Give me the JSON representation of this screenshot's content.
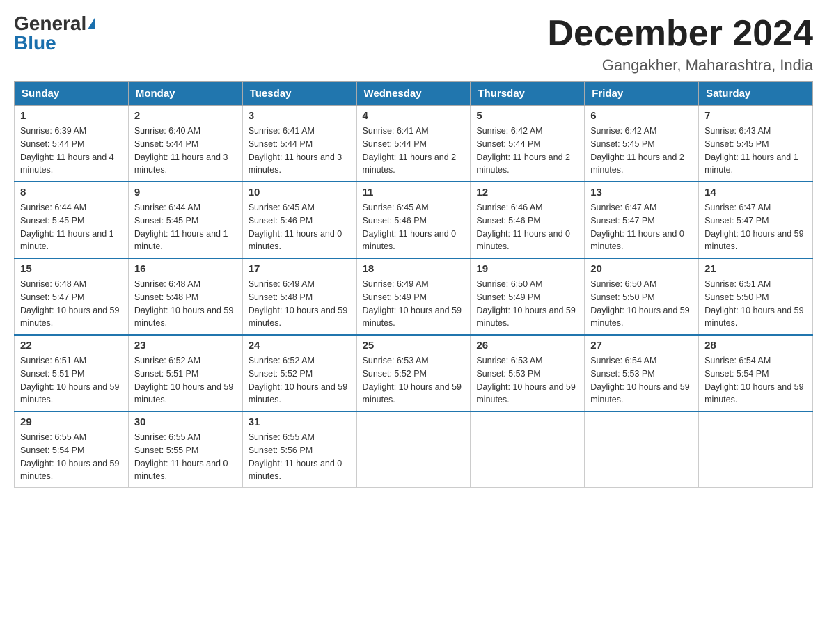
{
  "header": {
    "logo_general": "General",
    "logo_blue": "Blue",
    "month_year": "December 2024",
    "location": "Gangakher, Maharashtra, India"
  },
  "days_of_week": [
    "Sunday",
    "Monday",
    "Tuesday",
    "Wednesday",
    "Thursday",
    "Friday",
    "Saturday"
  ],
  "weeks": [
    [
      {
        "day": "1",
        "sunrise": "6:39 AM",
        "sunset": "5:44 PM",
        "daylight": "11 hours and 4 minutes."
      },
      {
        "day": "2",
        "sunrise": "6:40 AM",
        "sunset": "5:44 PM",
        "daylight": "11 hours and 3 minutes."
      },
      {
        "day": "3",
        "sunrise": "6:41 AM",
        "sunset": "5:44 PM",
        "daylight": "11 hours and 3 minutes."
      },
      {
        "day": "4",
        "sunrise": "6:41 AM",
        "sunset": "5:44 PM",
        "daylight": "11 hours and 2 minutes."
      },
      {
        "day": "5",
        "sunrise": "6:42 AM",
        "sunset": "5:44 PM",
        "daylight": "11 hours and 2 minutes."
      },
      {
        "day": "6",
        "sunrise": "6:42 AM",
        "sunset": "5:45 PM",
        "daylight": "11 hours and 2 minutes."
      },
      {
        "day": "7",
        "sunrise": "6:43 AM",
        "sunset": "5:45 PM",
        "daylight": "11 hours and 1 minute."
      }
    ],
    [
      {
        "day": "8",
        "sunrise": "6:44 AM",
        "sunset": "5:45 PM",
        "daylight": "11 hours and 1 minute."
      },
      {
        "day": "9",
        "sunrise": "6:44 AM",
        "sunset": "5:45 PM",
        "daylight": "11 hours and 1 minute."
      },
      {
        "day": "10",
        "sunrise": "6:45 AM",
        "sunset": "5:46 PM",
        "daylight": "11 hours and 0 minutes."
      },
      {
        "day": "11",
        "sunrise": "6:45 AM",
        "sunset": "5:46 PM",
        "daylight": "11 hours and 0 minutes."
      },
      {
        "day": "12",
        "sunrise": "6:46 AM",
        "sunset": "5:46 PM",
        "daylight": "11 hours and 0 minutes."
      },
      {
        "day": "13",
        "sunrise": "6:47 AM",
        "sunset": "5:47 PM",
        "daylight": "11 hours and 0 minutes."
      },
      {
        "day": "14",
        "sunrise": "6:47 AM",
        "sunset": "5:47 PM",
        "daylight": "10 hours and 59 minutes."
      }
    ],
    [
      {
        "day": "15",
        "sunrise": "6:48 AM",
        "sunset": "5:47 PM",
        "daylight": "10 hours and 59 minutes."
      },
      {
        "day": "16",
        "sunrise": "6:48 AM",
        "sunset": "5:48 PM",
        "daylight": "10 hours and 59 minutes."
      },
      {
        "day": "17",
        "sunrise": "6:49 AM",
        "sunset": "5:48 PM",
        "daylight": "10 hours and 59 minutes."
      },
      {
        "day": "18",
        "sunrise": "6:49 AM",
        "sunset": "5:49 PM",
        "daylight": "10 hours and 59 minutes."
      },
      {
        "day": "19",
        "sunrise": "6:50 AM",
        "sunset": "5:49 PM",
        "daylight": "10 hours and 59 minutes."
      },
      {
        "day": "20",
        "sunrise": "6:50 AM",
        "sunset": "5:50 PM",
        "daylight": "10 hours and 59 minutes."
      },
      {
        "day": "21",
        "sunrise": "6:51 AM",
        "sunset": "5:50 PM",
        "daylight": "10 hours and 59 minutes."
      }
    ],
    [
      {
        "day": "22",
        "sunrise": "6:51 AM",
        "sunset": "5:51 PM",
        "daylight": "10 hours and 59 minutes."
      },
      {
        "day": "23",
        "sunrise": "6:52 AM",
        "sunset": "5:51 PM",
        "daylight": "10 hours and 59 minutes."
      },
      {
        "day": "24",
        "sunrise": "6:52 AM",
        "sunset": "5:52 PM",
        "daylight": "10 hours and 59 minutes."
      },
      {
        "day": "25",
        "sunrise": "6:53 AM",
        "sunset": "5:52 PM",
        "daylight": "10 hours and 59 minutes."
      },
      {
        "day": "26",
        "sunrise": "6:53 AM",
        "sunset": "5:53 PM",
        "daylight": "10 hours and 59 minutes."
      },
      {
        "day": "27",
        "sunrise": "6:54 AM",
        "sunset": "5:53 PM",
        "daylight": "10 hours and 59 minutes."
      },
      {
        "day": "28",
        "sunrise": "6:54 AM",
        "sunset": "5:54 PM",
        "daylight": "10 hours and 59 minutes."
      }
    ],
    [
      {
        "day": "29",
        "sunrise": "6:55 AM",
        "sunset": "5:54 PM",
        "daylight": "10 hours and 59 minutes."
      },
      {
        "day": "30",
        "sunrise": "6:55 AM",
        "sunset": "5:55 PM",
        "daylight": "11 hours and 0 minutes."
      },
      {
        "day": "31",
        "sunrise": "6:55 AM",
        "sunset": "5:56 PM",
        "daylight": "11 hours and 0 minutes."
      },
      null,
      null,
      null,
      null
    ]
  ]
}
